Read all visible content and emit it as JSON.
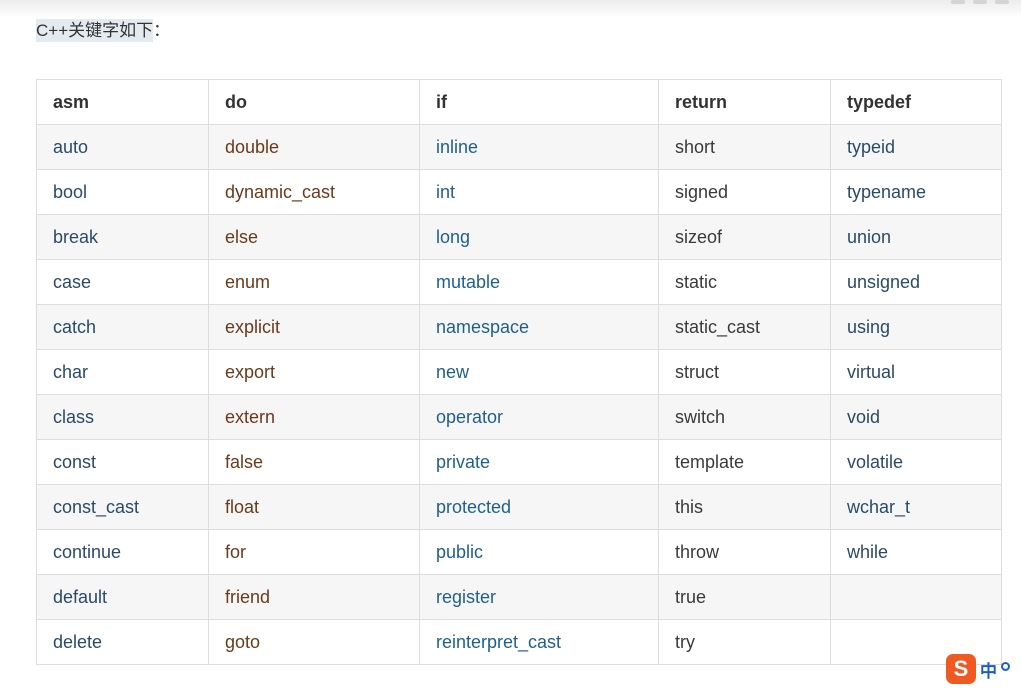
{
  "intro": {
    "text": "C++关键字如下",
    "colon": "："
  },
  "table": {
    "headers": [
      "asm",
      "do",
      "if",
      "return",
      "typedef"
    ],
    "rows": [
      [
        "auto",
        "double",
        "inline",
        "short",
        "typeid"
      ],
      [
        "bool",
        "dynamic_cast",
        "int",
        "signed",
        "typename"
      ],
      [
        "break",
        "else",
        "long",
        "sizeof",
        "union"
      ],
      [
        "case",
        "enum",
        "mutable",
        "static",
        "unsigned"
      ],
      [
        "catch",
        "explicit",
        "namespace",
        "static_cast",
        "using"
      ],
      [
        "char",
        "export",
        "new",
        "struct",
        "virtual"
      ],
      [
        "class",
        "extern",
        "operator",
        "switch",
        "void"
      ],
      [
        "const",
        "false",
        "private",
        "template",
        "volatile"
      ],
      [
        "const_cast",
        "float",
        "protected",
        "this",
        "wchar_t"
      ],
      [
        "continue",
        "for",
        "public",
        "throw",
        "while"
      ],
      [
        "default",
        "friend",
        "register",
        "true",
        ""
      ],
      [
        "delete",
        "goto",
        "reinterpret_cast",
        "try",
        ""
      ]
    ],
    "column_colors": [
      "#2a4a6a",
      "#6a3a1a",
      "#1f5f8f",
      "#3a3a3a",
      "#2a4a6a"
    ]
  },
  "ime": {
    "logo_char": "S",
    "lang_label": "中",
    "icon": "sogou-ime-icon"
  },
  "colors": {
    "border": "#dddddd",
    "stripe": "#f6f6f6",
    "highlight": "#e4ebf0"
  }
}
